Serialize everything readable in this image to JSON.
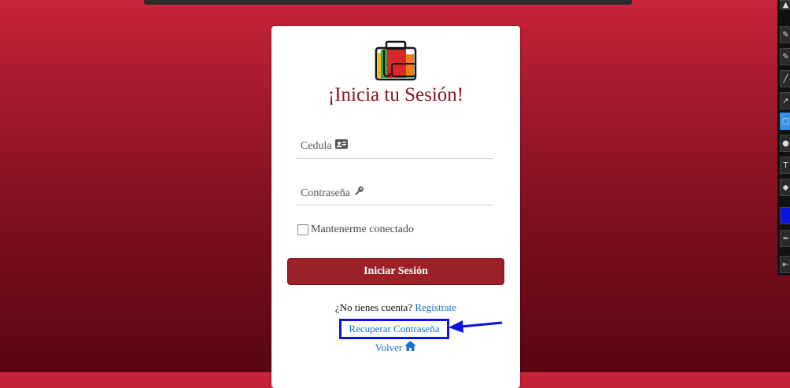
{
  "login": {
    "title": "¡Inicia tu Sesión!",
    "cedula_label": "Cedula",
    "password_label": "Contraseña",
    "remember_label": "Mantenerme conectado",
    "submit_label": "Iniciar Sesión",
    "no_account_text": "¿No tienes cuenta?",
    "register_link": "Regístrate",
    "recover_link": "Recuperar Contraseña",
    "back_link": "Volver"
  },
  "icons": {
    "cedula": "id-card-icon",
    "password": "key-icon",
    "back": "home-icon"
  },
  "colors": {
    "brand": "#9c2028",
    "title": "#8b1525",
    "link": "#1a6fd6",
    "annotation": "#0d14e0"
  }
}
